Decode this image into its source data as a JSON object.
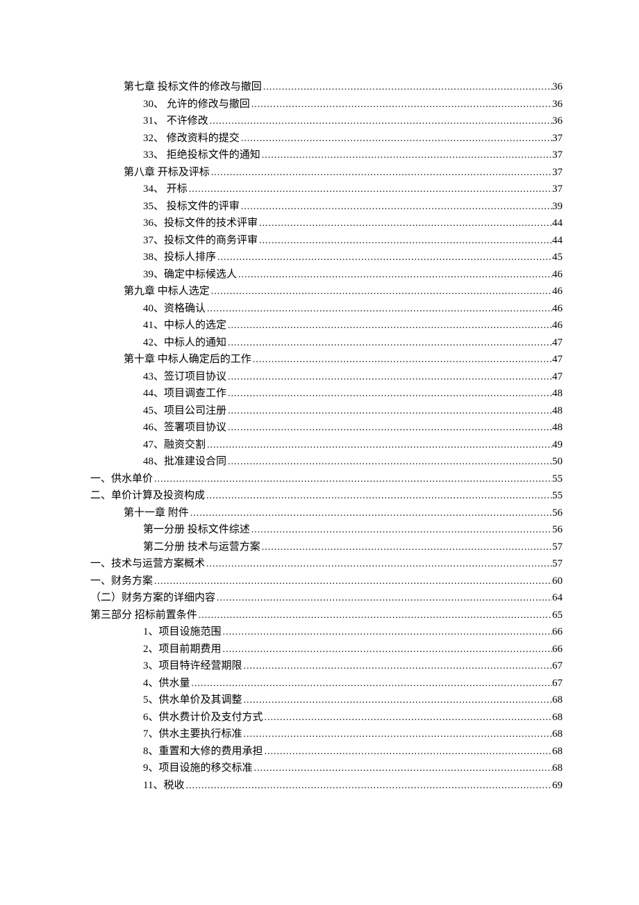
{
  "toc": [
    {
      "indent": 1,
      "label": "第七章 投标文件的修改与撤回",
      "page": "36"
    },
    {
      "indent": 2,
      "label": "30、 允许的修改与撤回",
      "page": "36"
    },
    {
      "indent": 2,
      "label": "31、 不许修改",
      "page": "36"
    },
    {
      "indent": 2,
      "label": "32、  修改资料的提交",
      "page": "37"
    },
    {
      "indent": 2,
      "label": "33、 拒绝投标文件的通知",
      "page": "37"
    },
    {
      "indent": 1,
      "label": "第八章   开标及评标",
      "page": "37"
    },
    {
      "indent": 2,
      "label": "34、 开标",
      "page": "37"
    },
    {
      "indent": 2,
      "label": "35、 投标文件的评审",
      "page": "39"
    },
    {
      "indent": 2,
      "label": "36、投标文件的技术评审",
      "page": "44"
    },
    {
      "indent": 2,
      "label": "37、投标文件的商务评审",
      "page": "44"
    },
    {
      "indent": 2,
      "label": "38、投标人排序",
      "page": "45"
    },
    {
      "indent": 2,
      "label": "39、确定中标候选人",
      "page": "46"
    },
    {
      "indent": 1,
      "label": "第九章    中标人选定",
      "page": "46"
    },
    {
      "indent": 2,
      "label": "40、资格确认",
      "page": "46"
    },
    {
      "indent": 2,
      "label": "41、中标人的选定",
      "page": "46"
    },
    {
      "indent": 2,
      "label": "42、中标人的通知",
      "page": "47"
    },
    {
      "indent": 1,
      "label": "第十章    中标人确定后的工作",
      "page": "47"
    },
    {
      "indent": 2,
      "label": "43、签订项目协议",
      "page": "47"
    },
    {
      "indent": 2,
      "label": "44、项目调查工作",
      "page": "48"
    },
    {
      "indent": 2,
      "label": "45、项目公司注册",
      "page": "48"
    },
    {
      "indent": 2,
      "label": "46、签署项目协议",
      "page": "48"
    },
    {
      "indent": 2,
      "label": "47、融资交割",
      "page": "49"
    },
    {
      "indent": 2,
      "label": "48、批准建设合同",
      "page": "50"
    },
    {
      "indent": 0,
      "label": "一、供水单价",
      "page": "55"
    },
    {
      "indent": 0,
      "label": "二、单价计算及投资构成",
      "page": "55"
    },
    {
      "indent": 1,
      "label": "第十一章   附件",
      "page": "56"
    },
    {
      "indent": 2,
      "label": "第一分册    投标文件综述",
      "page": "56"
    },
    {
      "indent": 2,
      "label": "第二分册    技术与运营方案",
      "page": "57"
    },
    {
      "indent": 0,
      "label": "一、技术与运营方案概术",
      "page": "57"
    },
    {
      "indent": 0,
      "label": "一、财务方案",
      "page": "60"
    },
    {
      "indent": 0,
      "label": "（二）财务方案的详细内容",
      "page": "64"
    },
    {
      "indent": 0,
      "label": "第三部分         招标前置条件",
      "page": "65"
    },
    {
      "indent": 2,
      "label": "1、项目设施范围",
      "page": "66"
    },
    {
      "indent": 2,
      "label": "2、项目前期费用",
      "page": "66"
    },
    {
      "indent": 2,
      "label": "3、项目特许经营期限",
      "page": "67"
    },
    {
      "indent": 2,
      "label": "4、供水量",
      "page": "67"
    },
    {
      "indent": 2,
      "label": "5、供水单价及其调整",
      "page": "68"
    },
    {
      "indent": 2,
      "label": "6、供水费计价及支付方式",
      "page": "68"
    },
    {
      "indent": 2,
      "label": "7、供水主要执行标准",
      "page": "68"
    },
    {
      "indent": 2,
      "label": "8、重置和大修的费用承担",
      "page": "68"
    },
    {
      "indent": 2,
      "label": "9、项目设施的移交标准",
      "page": "68"
    },
    {
      "indent": 2,
      "label": "11、税收",
      "page": "69"
    }
  ]
}
